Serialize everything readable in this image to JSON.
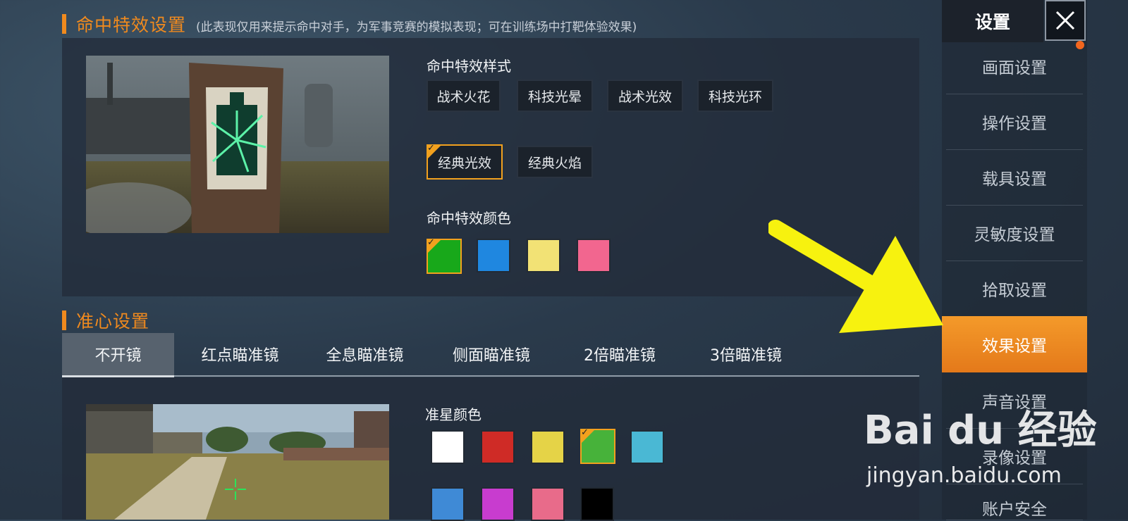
{
  "hit_effect": {
    "title": "命中特效设置",
    "note": "(此表现仅用来提示命中对手，为军事竞赛的模拟表现；可在训练场中打靶体验效果)",
    "style_label": "命中特效样式",
    "styles": [
      "战术火花",
      "科技光晕",
      "战术光效",
      "科技光环",
      "经典光效",
      "经典火焰"
    ],
    "selected_style": "经典光效",
    "color_label": "命中特效颜色",
    "colors": [
      "#18a81a",
      "#1f87e0",
      "#f2e275",
      "#f2668f"
    ],
    "selected_color": "#18a81a"
  },
  "crosshair": {
    "title": "准心设置",
    "tabs": [
      "不开镜",
      "红点瞄准镜",
      "全息瞄准镜",
      "侧面瞄准镜",
      "2倍瞄准镜",
      "3倍瞄准镜"
    ],
    "active_tab": "不开镜",
    "color_label": "准星颜色",
    "colors": [
      "#ffffff",
      "#cf2b26",
      "#e5d347",
      "#47b23a",
      "#4ab8d4",
      "#3f8ad6",
      "#c83ccf",
      "#e86b8a",
      "#000000"
    ],
    "selected_color": "#47b23a"
  },
  "sidebar": {
    "title": "设置",
    "items": [
      "画面设置",
      "操作设置",
      "载具设置",
      "灵敏度设置",
      "拾取设置",
      "效果设置",
      "声音设置",
      "录像设置",
      "账户安全"
    ],
    "active": "效果设置"
  },
  "watermark": {
    "brand": "Bai du 经验",
    "url": "jingyan.baidu.com"
  },
  "colors": {
    "accent": "#f08a1e",
    "highlight_arrow": "#f7f20f"
  }
}
